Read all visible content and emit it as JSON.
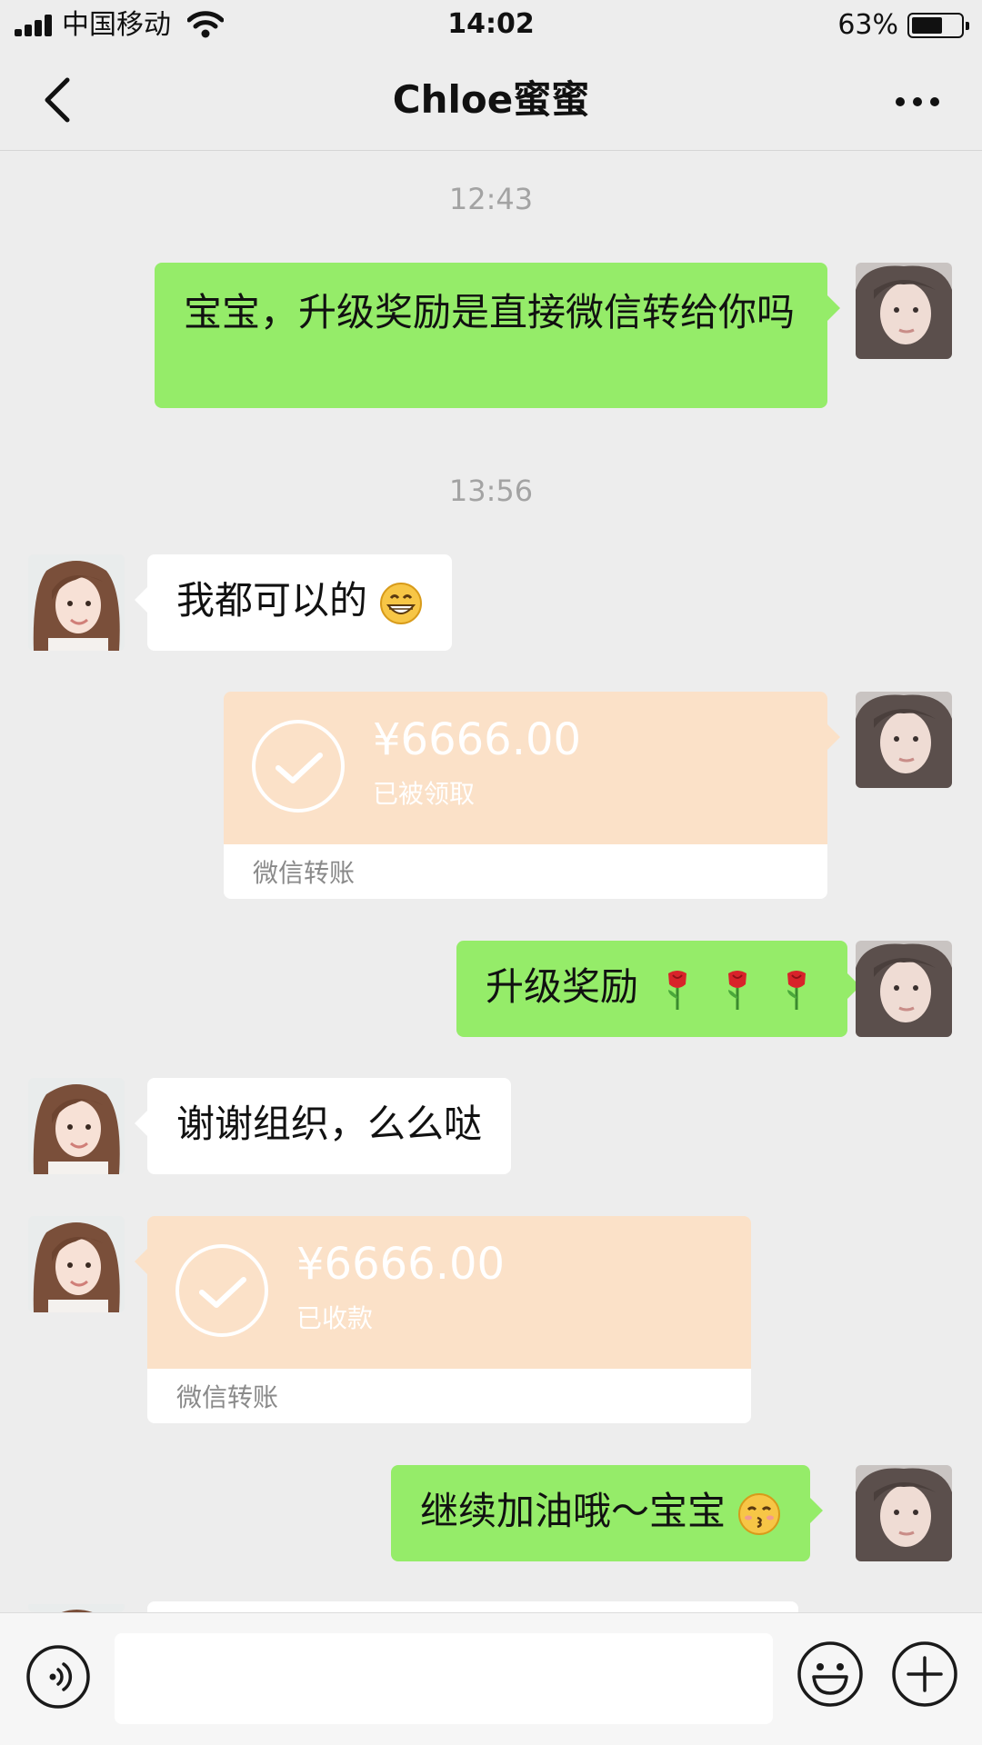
{
  "status_bar": {
    "carrier": "中国移动",
    "time": "14:02",
    "battery_percent": "63%",
    "battery_level": 0.63
  },
  "navbar": {
    "title": "Chloe蜜蜜",
    "back_icon": "chevron-left-icon",
    "more_icon": "more-dots-icon"
  },
  "chat": {
    "timestamp_1": "12:43",
    "msg_1": "宝宝，升级奖励是直接微信转给你吗",
    "timestamp_2": "13:56",
    "msg_2": "我都可以的",
    "msg_2_emoji": "grinning-face-icon",
    "transfer_1": {
      "amount": "¥6666.00",
      "status": "已被领取",
      "caption": "微信转账"
    },
    "msg_3": "升级奖励",
    "msg_3_emoji": "rose-icon",
    "msg_4": "谢谢组织，么么哒",
    "transfer_2": {
      "amount": "¥6666.00",
      "status": "已收款",
      "caption": "微信转账"
    },
    "msg_5": "继续加油哦～宝宝",
    "msg_5_emoji": "kissing-face-icon"
  },
  "input_bar": {
    "voice_icon": "voice-icon",
    "emoji_icon": "emoji-icon",
    "plus_icon": "plus-icon"
  },
  "colors": {
    "background": "#ededed",
    "sent_bubble": "#95ec69",
    "received_bubble": "#ffffff",
    "transfer_card": "#fbe1c8"
  }
}
